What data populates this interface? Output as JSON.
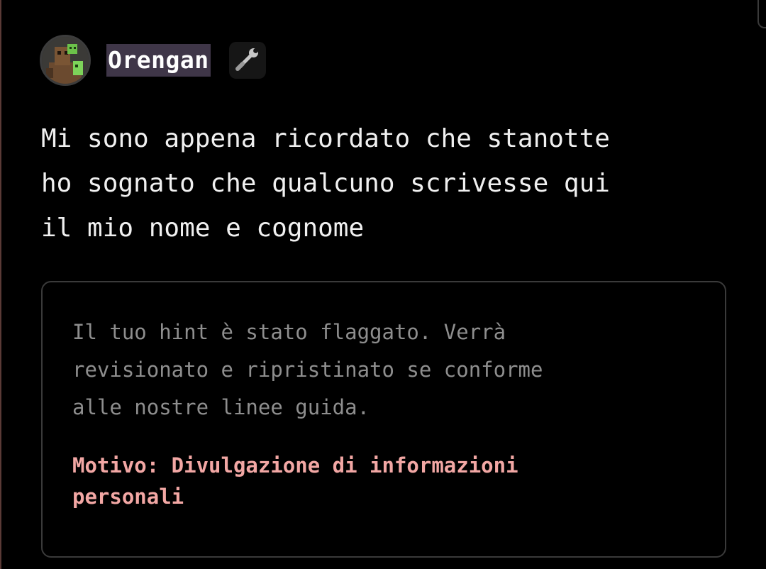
{
  "post": {
    "author": {
      "username": "Orengan",
      "badge_icon": "wrench-icon"
    },
    "body": "Mi sono appena ricordato che stanotte\nho sognato che qualcuno scrivesse qui\nil mio nome e cognome"
  },
  "moderation_notice": {
    "message": "Il tuo hint è stato flaggato. Verrà\nrevisionato e ripristinato se conforme\nalle nostre linee guida.",
    "reason": "Motivo: Divulgazione di informazioni\npersonali"
  },
  "colors": {
    "background": "#000000",
    "username_highlight": "#3f3648",
    "reason_text": "#f2a7a4",
    "notice_text": "#8e8e8e",
    "notice_border": "#3a3a3a"
  }
}
